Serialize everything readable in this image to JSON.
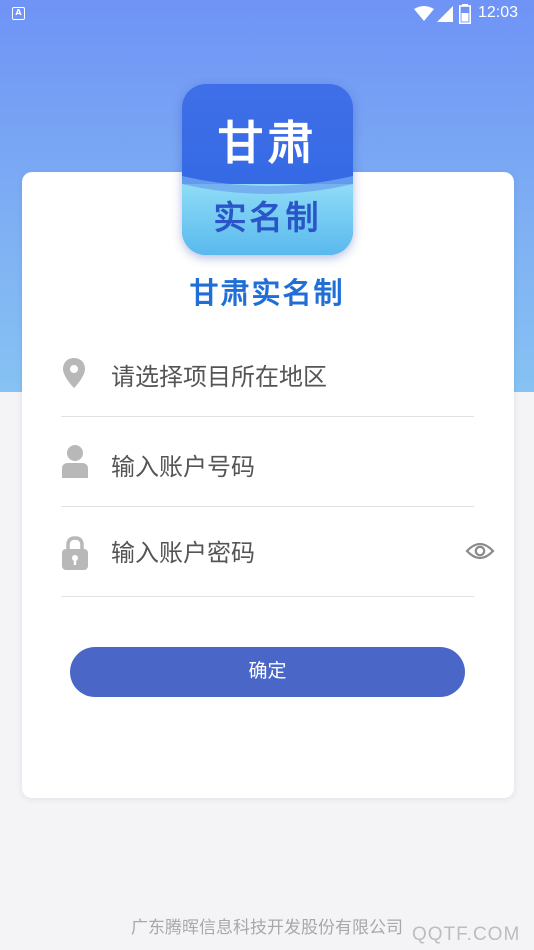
{
  "status_bar": {
    "app_indicator": "A",
    "time": "12:03",
    "icons": [
      "wifi-icon",
      "signal-icon",
      "battery-icon"
    ]
  },
  "logo": {
    "top_text": "甘肃",
    "bottom_text": "实名制"
  },
  "app_name": "甘肃实名制",
  "form": {
    "region_placeholder": "请选择项目所在地区",
    "account_placeholder": "输入账户号码",
    "password_placeholder": "输入账户密码",
    "confirm_label": "确定"
  },
  "footer": {
    "company": "广东腾晖信息科技开发股份有限公司",
    "watermark": "QQTF.COM"
  },
  "colors": {
    "header_gradient_top": "#6f93f6",
    "header_gradient_bottom": "#86c2f3",
    "brand_blue": "#1f6fd6",
    "button": "#4a67c8"
  }
}
